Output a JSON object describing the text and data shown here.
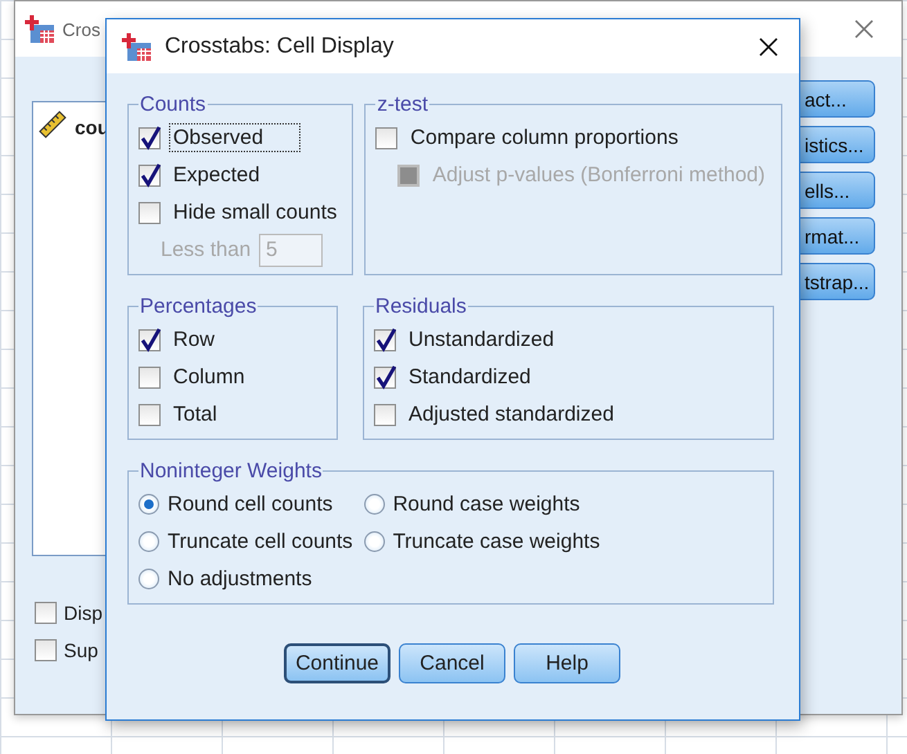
{
  "background_window": {
    "title": "Cros",
    "list_items": [
      {
        "label": "cou"
      }
    ],
    "buttons": [
      "act...",
      "istics...",
      "ells...",
      "rmat...",
      "tstrap..."
    ],
    "checkboxes": [
      {
        "label": "Disp",
        "checked": false
      },
      {
        "label": "Sup",
        "checked": false
      }
    ]
  },
  "dialog": {
    "title": "Crosstabs: Cell Display",
    "groups": [
      {
        "title": "Counts",
        "items": [
          {
            "kind": "checkbox",
            "label": "Observed",
            "checked": true,
            "focused": true
          },
          {
            "kind": "checkbox",
            "label": "Expected",
            "checked": true
          },
          {
            "kind": "checkbox",
            "label": "Hide small counts",
            "checked": false
          },
          {
            "kind": "number_field",
            "label": "Less than",
            "value": "5",
            "disabled": true
          }
        ]
      },
      {
        "title": "z-test",
        "items": [
          {
            "kind": "checkbox",
            "label": "Compare column proportions",
            "checked": false
          },
          {
            "kind": "checkbox",
            "label": "Adjust p-values (Bonferroni method)",
            "checked": false,
            "disabled": true
          }
        ]
      },
      {
        "title": "Percentages",
        "items": [
          {
            "kind": "checkbox",
            "label": "Row",
            "checked": true
          },
          {
            "kind": "checkbox",
            "label": "Column",
            "checked": false
          },
          {
            "kind": "checkbox",
            "label": "Total",
            "checked": false
          }
        ]
      },
      {
        "title": "Residuals",
        "items": [
          {
            "kind": "checkbox",
            "label": "Unstandardized",
            "checked": true
          },
          {
            "kind": "checkbox",
            "label": "Standardized",
            "checked": true
          },
          {
            "kind": "checkbox",
            "label": "Adjusted standardized",
            "checked": false
          }
        ]
      },
      {
        "title": "Noninteger Weights",
        "items": [
          {
            "kind": "radio",
            "label": "Round cell counts",
            "selected": true
          },
          {
            "kind": "radio",
            "label": "Round case weights",
            "selected": false
          },
          {
            "kind": "radio",
            "label": "Truncate cell counts",
            "selected": false
          },
          {
            "kind": "radio",
            "label": "Truncate case weights",
            "selected": false
          },
          {
            "kind": "radio",
            "label": "No adjustments",
            "selected": false
          }
        ]
      }
    ],
    "buttons": [
      {
        "label": "Continue",
        "default": true
      },
      {
        "label": "Cancel",
        "default": false
      },
      {
        "label": "Help",
        "default": false
      }
    ]
  }
}
